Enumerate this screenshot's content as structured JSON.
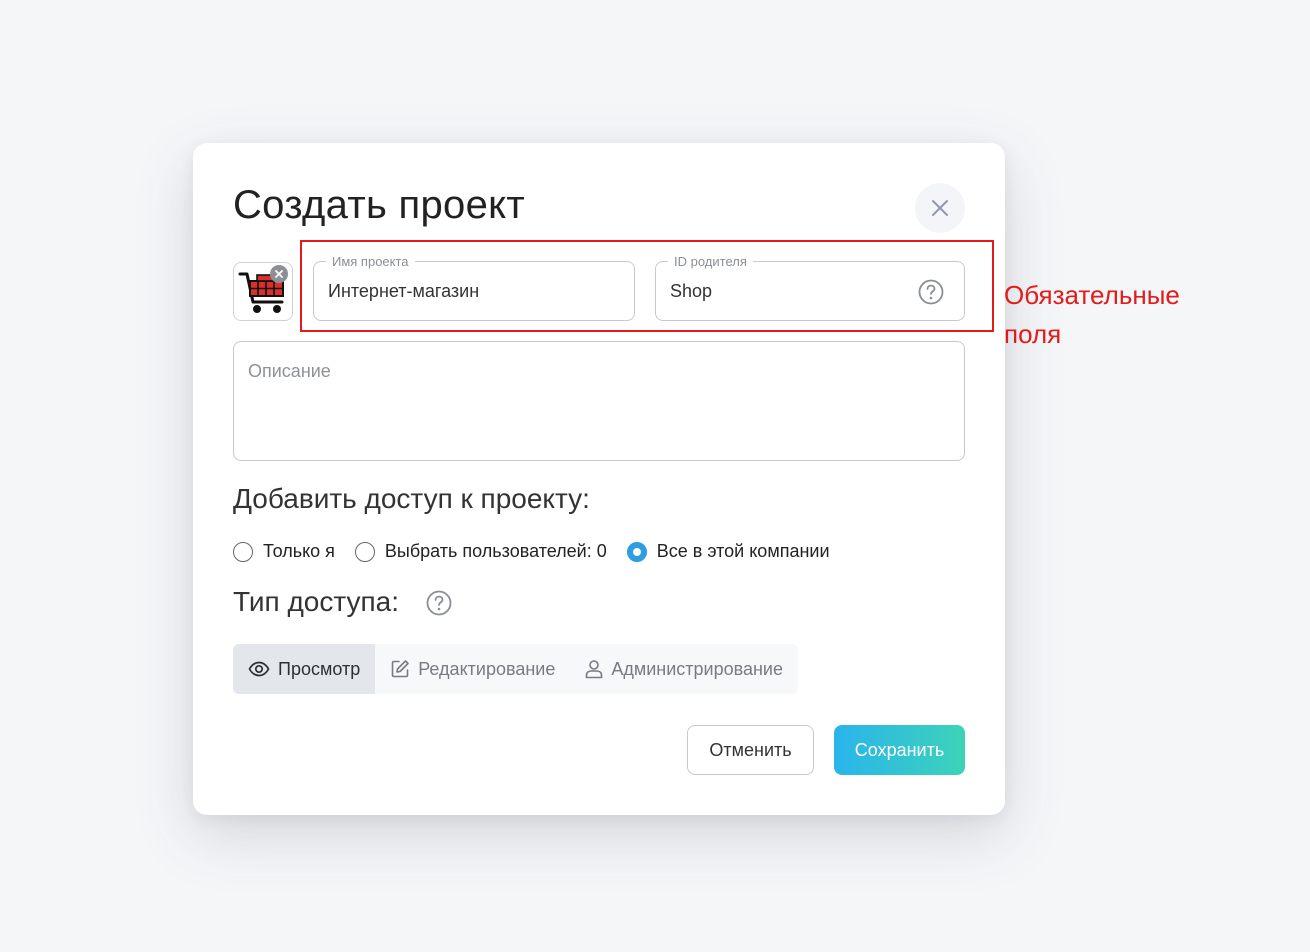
{
  "modal": {
    "title": "Создать проект",
    "close_icon": "close-icon"
  },
  "avatar": {
    "image_icon": "shopping-cart-icon",
    "remove_icon": "close-icon"
  },
  "project_name": {
    "label": "Имя проекта",
    "value": "Интернет-магазин"
  },
  "parent_id": {
    "label": "ID родителя",
    "value": "Shop",
    "help_icon": "question-circle-icon"
  },
  "description": {
    "placeholder": "Описание"
  },
  "access": {
    "heading": "Добавить доступ к проекту:",
    "options": [
      {
        "label": "Только я",
        "checked": false
      },
      {
        "label": "Выбрать пользователей: 0",
        "checked": false
      },
      {
        "label": "Все в этой компании",
        "checked": true
      }
    ]
  },
  "access_type": {
    "heading": "Тип доступа:",
    "help_icon": "question-circle-icon",
    "tabs": [
      {
        "label": "Просмотр",
        "icon": "eye-icon",
        "active": true
      },
      {
        "label": "Редактирование",
        "icon": "edit-icon",
        "active": false
      },
      {
        "label": "Администрирование",
        "icon": "user-icon",
        "active": false
      }
    ]
  },
  "buttons": {
    "cancel": "Отменить",
    "save": "Сохранить"
  },
  "annotation": {
    "text_line1": "Обязательные",
    "text_line2": "поля",
    "color": "#e41b1b"
  },
  "colors": {
    "accent_start": "#2ab4ec",
    "accent_end": "#3cd3b8",
    "radio_checked": "#2d9fe0"
  }
}
